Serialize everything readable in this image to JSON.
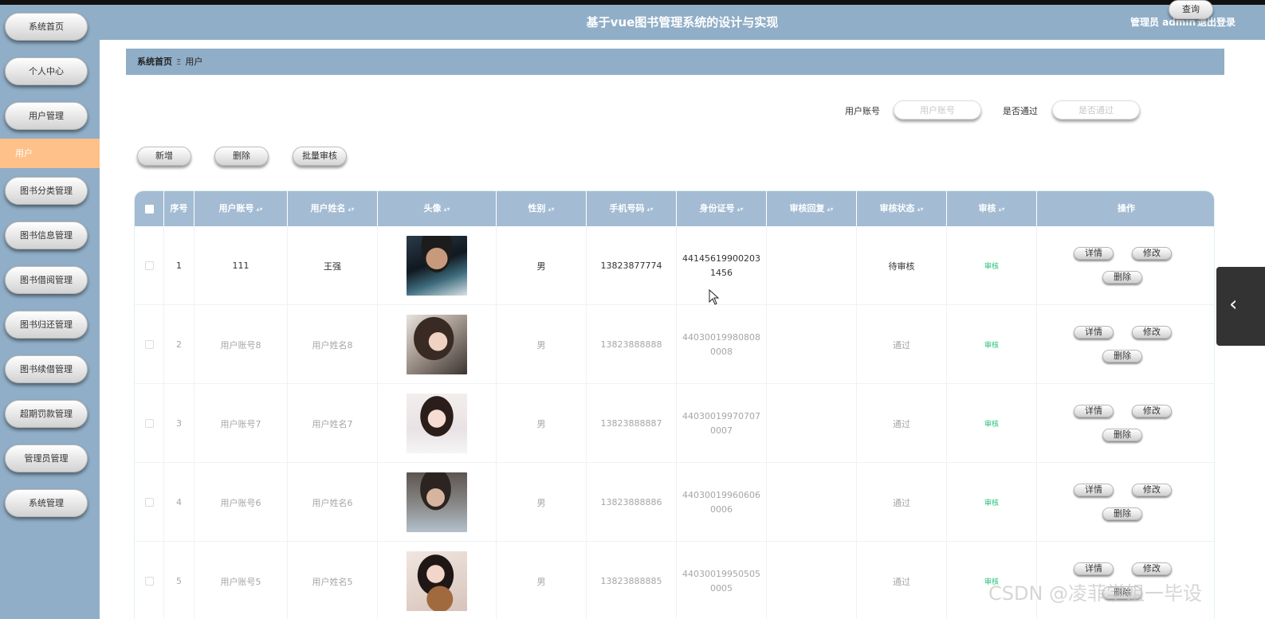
{
  "header": {
    "title": "基于vue图书管理系统的设计与实现",
    "user": "管理员 admin",
    "logout": "退出登录"
  },
  "sidebar": {
    "items": [
      {
        "label": "系统首页"
      },
      {
        "label": "个人中心"
      },
      {
        "label": "用户管理"
      },
      {
        "label": "图书分类管理"
      },
      {
        "label": "图书信息管理"
      },
      {
        "label": "图书借阅管理"
      },
      {
        "label": "图书归还管理"
      },
      {
        "label": "图书续借管理"
      },
      {
        "label": "超期罚款管理"
      },
      {
        "label": "管理员管理"
      },
      {
        "label": "系统管理"
      }
    ],
    "active_sub": "用户"
  },
  "breadcrumb": {
    "home": "系统首页",
    "separator": "Ξ",
    "current": "用户"
  },
  "search": {
    "account_label": "用户账号",
    "account_placeholder": "用户账号",
    "pass_label": "是否通过",
    "pass_placeholder": "是否通过",
    "query_button": "查询"
  },
  "toolbar": {
    "add": "新增",
    "delete": "删除",
    "batch_audit": "批量审核"
  },
  "table": {
    "columns": {
      "index": "序号",
      "account": "用户账号",
      "name": "用户姓名",
      "avatar": "头像",
      "gender": "性别",
      "phone": "手机号码",
      "idcard": "身份证号",
      "reply": "审核回复",
      "status": "审核状态",
      "audit": "审核",
      "ops": "操作"
    },
    "rows": [
      {
        "index": "1",
        "account": "111",
        "name": "王强",
        "gender": "男",
        "phone": "13823877774",
        "idcard": "441456199002031456",
        "reply": "",
        "status": "待审核",
        "audit": "审核"
      },
      {
        "index": "2",
        "account": "用户账号8",
        "name": "用户姓名8",
        "gender": "男",
        "phone": "13823888888",
        "idcard": "440300199808080008",
        "reply": "",
        "status": "通过",
        "audit": "审核"
      },
      {
        "index": "3",
        "account": "用户账号7",
        "name": "用户姓名7",
        "gender": "男",
        "phone": "13823888887",
        "idcard": "440300199707070007",
        "reply": "",
        "status": "通过",
        "audit": "审核"
      },
      {
        "index": "4",
        "account": "用户账号6",
        "name": "用户姓名6",
        "gender": "男",
        "phone": "13823888886",
        "idcard": "440300199606060006",
        "reply": "",
        "status": "通过",
        "audit": "审核"
      },
      {
        "index": "5",
        "account": "用户账号5",
        "name": "用户姓名5",
        "gender": "男",
        "phone": "13823888885",
        "idcard": "440300199505050005",
        "reply": "",
        "status": "通过",
        "audit": "审核"
      }
    ],
    "op_buttons": {
      "detail": "详情",
      "edit": "修改",
      "delete": "删除"
    }
  },
  "watermark": "CSDN @凌菲学姐一毕设",
  "colors": {
    "sidebar": "#90aec7",
    "header": "#90aec7",
    "active": "#fdc189",
    "table_head": "#a3bcd3",
    "audit_link": "#27c27c"
  }
}
